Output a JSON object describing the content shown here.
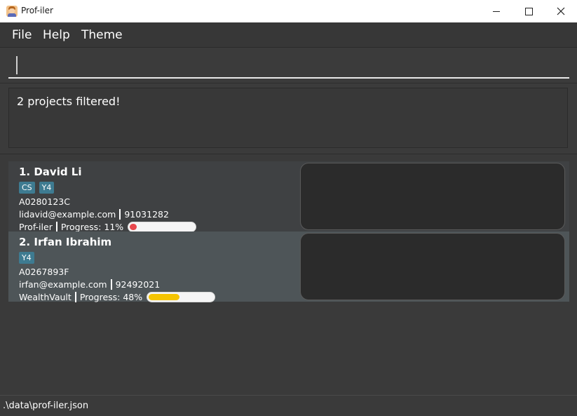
{
  "window": {
    "title": "Prof-iler",
    "minimize_icon": "minimize-icon",
    "maximize_icon": "maximize-icon",
    "close_icon": "close-icon"
  },
  "menu": {
    "items": [
      {
        "label": "File"
      },
      {
        "label": "Help"
      },
      {
        "label": "Theme"
      }
    ]
  },
  "command": {
    "value": "",
    "placeholder": ""
  },
  "result": {
    "message": "2 projects filtered!"
  },
  "persons": [
    {
      "title": "1. David Li",
      "tags": [
        "CS",
        "Y4"
      ],
      "id": "A0280123C",
      "email": "lidavid@example.com",
      "phone": "91031282",
      "project": "Prof-iler",
      "progress_label": "Progress: 11%",
      "progress_value": 0.11,
      "progress_color": "#e8474d"
    },
    {
      "title": "2. Irfan Ibrahim",
      "tags": [
        "Y4"
      ],
      "id": "A0267893F",
      "email": "irfan@example.com",
      "phone": "92492021",
      "project": "WealthVault",
      "progress_label": "Progress: 48%",
      "progress_value": 0.48,
      "progress_color": "#f5c400"
    }
  ],
  "status": {
    "file_path": ".\\data\\prof-iler.json"
  }
}
